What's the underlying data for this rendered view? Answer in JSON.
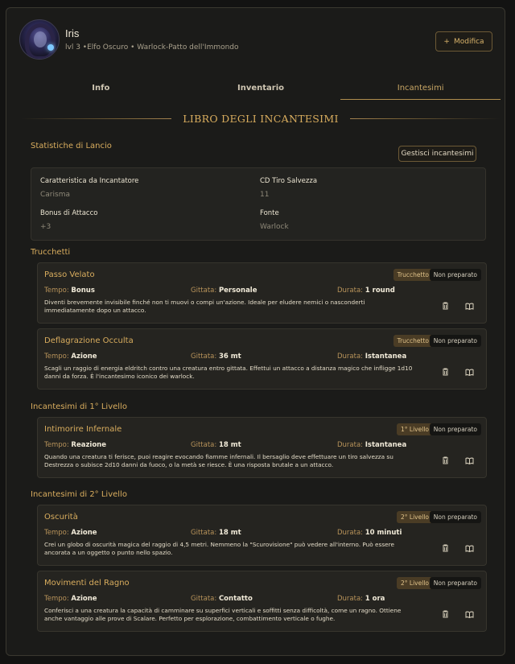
{
  "character": {
    "name": "Iris",
    "subtitle": "lvl 3 •Elfo Oscuro • Warlock-Patto dell'Immondo",
    "edit_icon": "+",
    "edit_label": "Modifica"
  },
  "tabs": [
    {
      "label": "Info",
      "active": false
    },
    {
      "label": "Inventario",
      "active": false
    },
    {
      "label": "Incantesimi",
      "active": true
    }
  ],
  "book_title": "LIBRO DEGLI INCANTESIMI",
  "launch": {
    "section_label": "Statistiche di Lancio",
    "manage_label": "Gestisci incantesimi",
    "stats": [
      {
        "label": "Caratteristica da Incantatore",
        "value": "Carisma"
      },
      {
        "label": "CD Tiro Salvezza",
        "value": "11"
      },
      {
        "label": "Bonus di Attacco",
        "value": "+3"
      },
      {
        "label": "Fonte",
        "value": "Warlock"
      }
    ]
  },
  "meta_labels": {
    "time": "Tempo:",
    "range": "Gittata:",
    "duration": "Durata:"
  },
  "groups": [
    {
      "label": "Trucchetti",
      "spells": [
        {
          "name": "Passo Velato",
          "level_badge": "Trucchetto",
          "prep_badge": "Non preparato",
          "time": "Bonus",
          "range": "Personale",
          "duration": "1 round",
          "description": "Diventi brevemente invisibile finché non ti muovi o compi un'azione. Ideale per eludere nemici o nasconderti immediatamente dopo un attacco."
        },
        {
          "name": "Deflagrazione Occulta",
          "level_badge": "Trucchetto",
          "prep_badge": "Non preparato",
          "time": "Azione",
          "range": "36 mt",
          "duration": "Istantanea",
          "description": "Scagli un raggio di energia eldritch contro una creatura entro gittata. Effettui un attacco a distanza magico che infligge 1d10 danni da forza. È l'incantesimo iconico dei warlock."
        }
      ]
    },
    {
      "label": "Incantesimi di 1° Livello",
      "spells": [
        {
          "name": "Intimorire Infernale",
          "level_badge": "1° Livello",
          "prep_badge": "Non preparato",
          "time": "Reazione",
          "range": "18 mt",
          "duration": "Istantanea",
          "description": "Quando una creatura ti ferisce, puoi reagire evocando fiamme infernali. Il bersaglio deve effettuare un tiro salvezza su Destrezza o subisce 2d10 danni da fuoco, o la metà se riesce. È una risposta brutale a un attacco."
        }
      ]
    },
    {
      "label": "Incantesimi di 2° Livello",
      "spells": [
        {
          "name": "Oscurità",
          "level_badge": "2° Livello",
          "prep_badge": "Non preparato",
          "time": "Azione",
          "range": "18 mt",
          "duration": "10 minuti",
          "description": "Crei un globo di oscurità magica del raggio di 4,5 metri. Nemmeno la \"Scurovisione\" può vedere all'interno. Può essere ancorata a un oggetto o punto nello spazio."
        },
        {
          "name": "Movimenti del Ragno",
          "level_badge": "2° Livello",
          "prep_badge": "Non preparato",
          "time": "Azione",
          "range": "Contatto",
          "duration": "1 ora",
          "description": "Conferisci a una creatura la capacità di camminare su superfici verticali e soffitti senza difficoltà, come un ragno. Ottiene anche vantaggio alle prove di Scalare. Perfetto per esplorazione, combattimento verticale o fughe."
        }
      ]
    }
  ]
}
